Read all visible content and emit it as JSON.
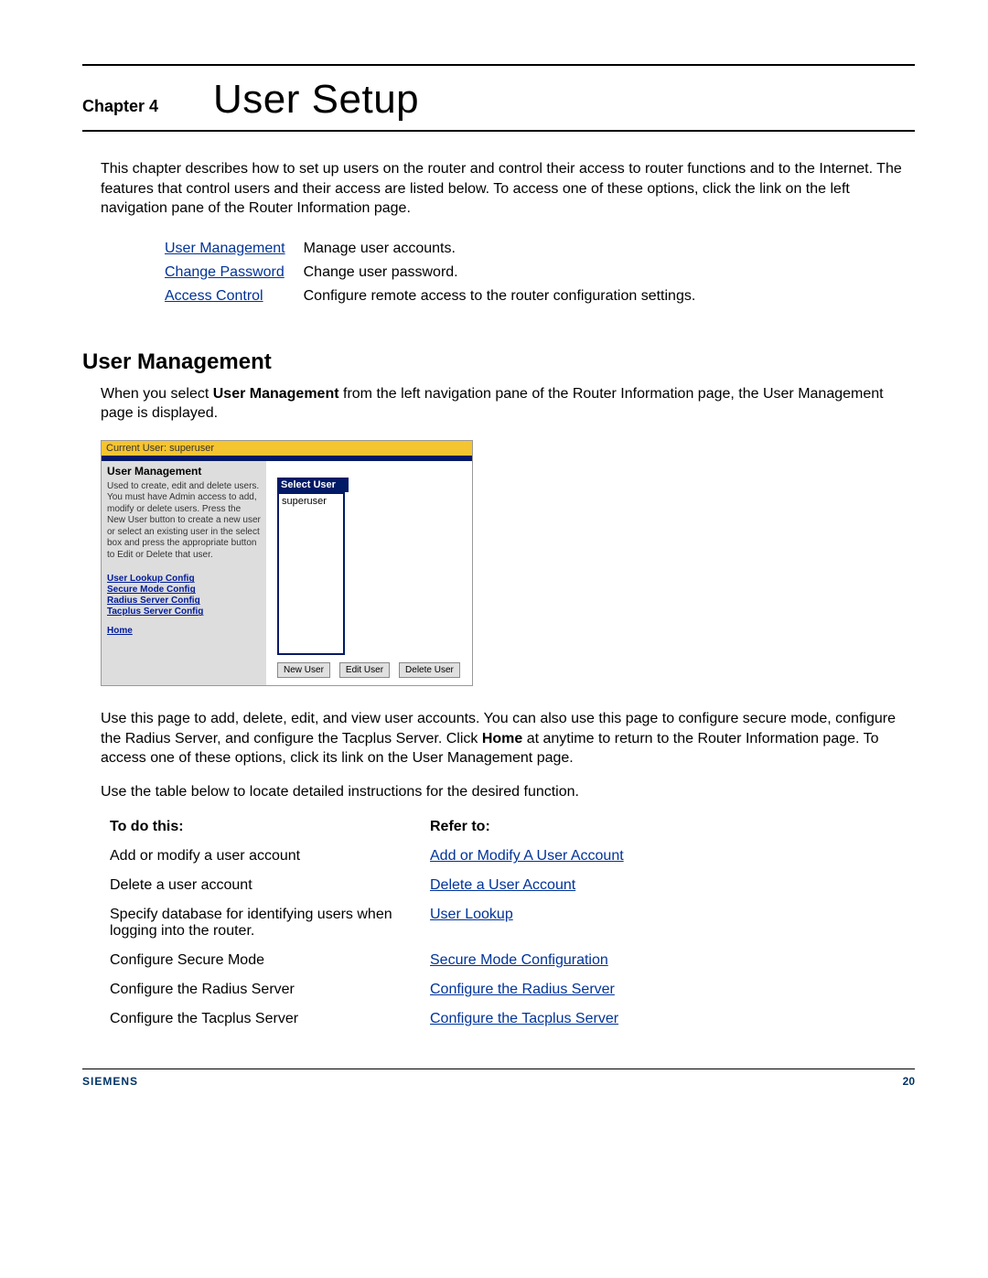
{
  "header": {
    "chapter_label": "Chapter 4",
    "title": "User Setup"
  },
  "intro": "This chapter describes how to set up users on the router and control their access to router functions and to the Internet. The features that control users and their access are listed below. To access one of these options, click the link on the left navigation pane of the Router Information page.",
  "intro_links": [
    {
      "link": "User Management",
      "desc": "Manage user accounts."
    },
    {
      "link": "Change Password",
      "desc": "Change user password."
    },
    {
      "link": "Access Control",
      "desc": "Configure remote access to the router configuration settings."
    }
  ],
  "section": {
    "title": "User Management",
    "para_pre": "When you select ",
    "para_bold": "User Management",
    "para_post": " from the left navigation pane of the Router Information page, the User Management page is displayed."
  },
  "screenshot": {
    "topbar": "Current User: superuser",
    "left_title": "User Management",
    "left_text": "Used to create, edit and delete users. You must have Admin access to add, modify or delete users. Press the New User button to create a new user or select an existing user in the select box and press the appropriate button to Edit or Delete that user.",
    "left_links": [
      "User Lookup Config",
      "Secure Mode Config",
      "Radius Server Config",
      "Tacplus Server Config"
    ],
    "home": "Home",
    "select_title": "Select User",
    "user_in_list": "superuser",
    "buttons": [
      "New User",
      "Edit User",
      "Delete User"
    ]
  },
  "post_ss_para1_pre": "Use this page to add, delete, edit, and view user accounts. You can also use this page to configure secure mode, configure the Radius Server, and configure the Tacplus Server. Click ",
  "post_ss_para1_bold": "Home",
  "post_ss_para1_post": " at anytime to return to the Router Information page. To access one of these options, click its link on the User Management page.",
  "post_ss_para2": "Use the table below to locate detailed instructions for the desired function.",
  "ref_table": {
    "col1_head": "To do this:",
    "col2_head": "Refer to:",
    "rows": [
      {
        "task": "Add or modify a user account",
        "link": "Add or Modify A User Account"
      },
      {
        "task": "Delete a user account",
        "link": "Delete a User Account"
      },
      {
        "task": "Specify database for identifying users when logging into the router.",
        "link": "User Lookup"
      },
      {
        "task": "Configure Secure Mode",
        "link": "Secure Mode Configuration"
      },
      {
        "task": "Configure the Radius Server",
        "link": "Configure the Radius Server"
      },
      {
        "task": "Configure the Tacplus Server",
        "link": "Configure the Tacplus Server"
      }
    ]
  },
  "footer": {
    "brand": "SIEMENS",
    "page": "20"
  }
}
